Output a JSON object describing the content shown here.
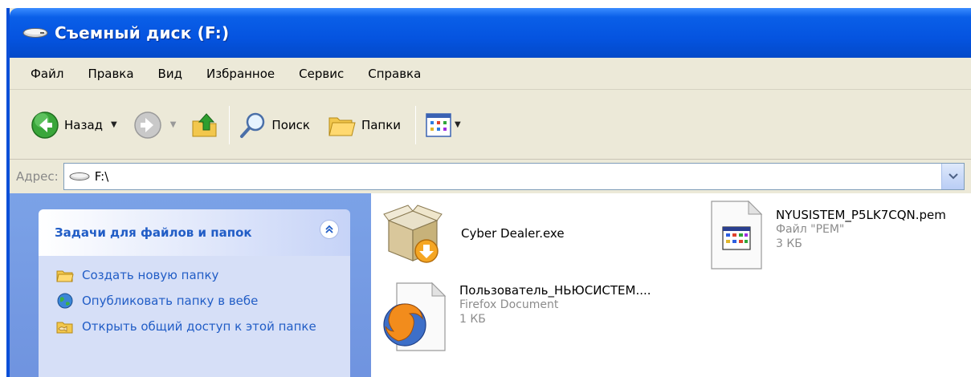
{
  "window": {
    "title": "Съемный диск (F:)"
  },
  "menu": {
    "items": [
      "Файл",
      "Правка",
      "Вид",
      "Избранное",
      "Сервис",
      "Справка"
    ]
  },
  "toolbar": {
    "back_label": "Назад",
    "search_label": "Поиск",
    "folders_label": "Папки"
  },
  "address": {
    "label": "Адрес:",
    "value": "F:\\"
  },
  "tasks": {
    "title": "Задачи для файлов и папок",
    "items": [
      {
        "label": "Создать новую папку",
        "icon": "new-folder-icon"
      },
      {
        "label": "Опубликовать папку в вебе",
        "icon": "publish-web-icon"
      },
      {
        "label": "Открыть общий доступ к этой папке",
        "icon": "share-folder-icon"
      }
    ]
  },
  "files": [
    {
      "name": "Cyber Dealer.exe",
      "type": "",
      "size": "",
      "icon": "installer-box-icon"
    },
    {
      "name": "NYUSISTEM_P5LK7CQN.pem",
      "type": "Файл \"PEM\"",
      "size": "3 КБ",
      "icon": "pem-file-icon"
    },
    {
      "name": "Пользователь_НЬЮСИСТЕМ....",
      "type": "Firefox Document",
      "size": "1 КБ",
      "icon": "firefox-document-icon"
    }
  ],
  "colors": {
    "titlebar": "#0554e0",
    "task_link": "#215dc6",
    "left_pane": "#7ba2e7"
  }
}
